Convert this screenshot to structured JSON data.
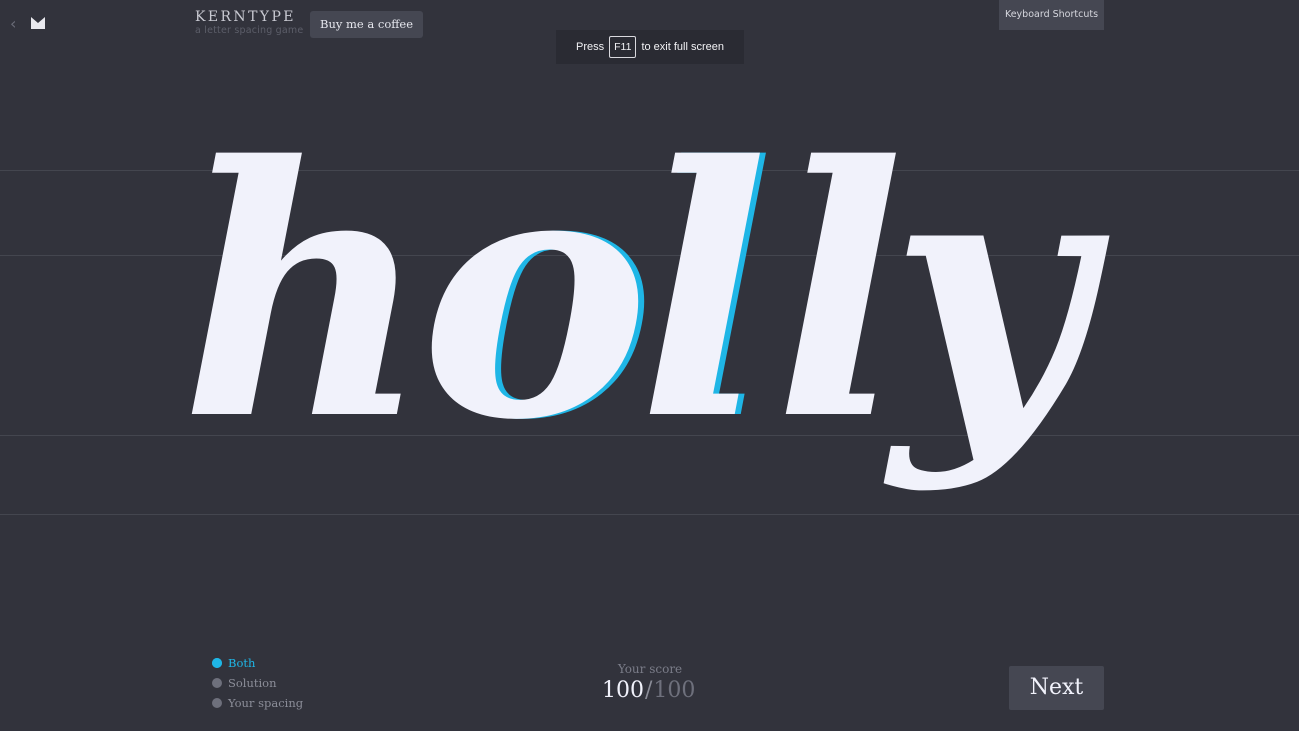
{
  "header": {
    "brand_title": "KERNTYPE",
    "brand_subtitle": "a letter spacing game",
    "coffee_label": "Buy me a coffee",
    "shortcuts_label": "Keyboard Shortcuts",
    "back_icon": "chevron-left-icon",
    "logo_icon": "method-logo-icon"
  },
  "fullscreen_notice": {
    "before": "Press",
    "key": "F11",
    "after": "to exit full screen"
  },
  "word": {
    "letters": [
      "h",
      "o",
      "l",
      "l",
      "y"
    ],
    "letter_color": "#f1f2fb",
    "solution_color": "#1fb6e6"
  },
  "view_options": [
    {
      "label": "Both",
      "selected": true
    },
    {
      "label": "Solution",
      "selected": false
    },
    {
      "label": "Your spacing",
      "selected": false
    }
  ],
  "score": {
    "label": "Your score",
    "value": "100",
    "separator": "/",
    "max": "100"
  },
  "next_label": "Next",
  "colors": {
    "background": "#32333c",
    "accent": "#1fb6e6",
    "button": "#454752"
  }
}
